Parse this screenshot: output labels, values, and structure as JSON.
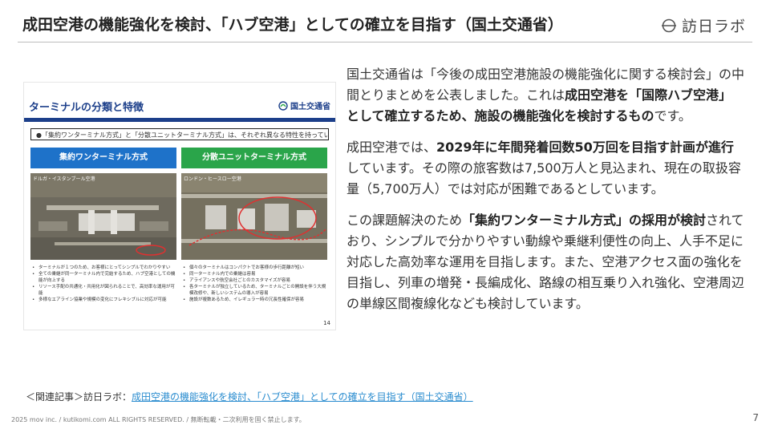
{
  "header": {
    "title": "成田空港の機能強化を検討、「ハブ空港」としての確立を目指す（国土交通省）",
    "logo_text": "訪日ラボ"
  },
  "slide": {
    "title": "ターミナルの分類と特徴",
    "ministry": "国土交通省",
    "note": "●「集約ワンターミナル方式」と「分散ユニットターミナル方式」は、それぞれ異なる特性を持っている",
    "left": {
      "heading": "集約ワンターミナル方式",
      "photo_caption": "ドルガ・イスタンブール空港",
      "bullets": [
        "ターミナルが１つのため、お客様にとってシンプルでわかりやすい",
        "全ての乗継が同一ターミナル内で完結するため、ハブ空港としての機能が向上する",
        "リソース手配の共通化・共用化が図られることで、高効率な運用が可能",
        "多様なエアライン協業や規模の変化にフレキシブルに対応が可能"
      ]
    },
    "right": {
      "heading": "分散ユニットターミナル方式",
      "photo_caption": "ロンドン・ヒースロー空港",
      "bullets": [
        "個々のターミナルはコンパクトでお客様の歩行距離が短い",
        "同一ターミナル内での乗継は容易",
        "アライアンスや航空会社ごとのカスタマイズが容易",
        "各ターミナルが独立しているため、ターミナルごとの開設を伴う大規模改修や、新しいシステムの導入が容易",
        "施設が複数あるため、イレギュラー時の冗長性確保が容易"
      ]
    },
    "page": "14"
  },
  "body": {
    "p1": {
      "t1": "国土交通省は「今後の成田空港施設の機能強化に関する検討会」の中間とりまとめを公表しました。これは",
      "b1": "成田空港を「国際ハブ空港」として確立するため、施設の機能強化を検討するもの",
      "t2": "です。"
    },
    "p2": {
      "t1": "成田空港では、",
      "b1": "2029年に年間発着回数50万回を目指す計画が進行",
      "t2": "しています。その際の旅客数は7,500万人と見込まれ、現在の取扱容量（5,700万人）では対応が困難であるとしています。"
    },
    "p3": {
      "t1": "この課題解決のため",
      "b1": "「集約ワンターミナル方式」の採用が検討",
      "t2": "されており、シンプルで分かりやすい動線や乗継利便性の向上、人手不足に対応した高効率な運用を目指します。また、空港アクセス面の強化を目指し、列車の増発・長編成化、路線の相互乗り入れ強化、空港周辺の単線区間複線化なども検討しています。"
    }
  },
  "related": {
    "prefix": "＜関連記事＞訪日ラボ：",
    "link": "成田空港の機能強化を検討、「ハブ空港」としての確立を目指す（国土交通省）"
  },
  "footer": {
    "copyright": "2025 mov inc. / kutikomi.com ALL RIGHTS RESERVED. / 無断転載・二次利用を固く禁止します。",
    "page": "7"
  }
}
